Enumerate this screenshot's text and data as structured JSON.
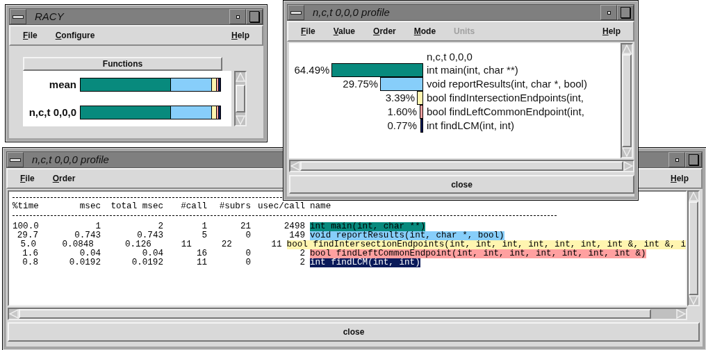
{
  "racy_window": {
    "title": "RACY",
    "menu": [
      {
        "label": "File",
        "disabled": false
      },
      {
        "label": "Configure",
        "disabled": false
      }
    ],
    "menu_right": [
      {
        "label": "Help",
        "disabled": false
      }
    ],
    "header": "Functions",
    "rows": [
      {
        "label": "mean"
      },
      {
        "label": "n,c,t 0,0,0"
      }
    ]
  },
  "table_window": {
    "title": "n,c,t 0,0,0 profile",
    "menu": [
      {
        "label": "File",
        "disabled": false
      },
      {
        "label": "Order",
        "disabled": false
      }
    ],
    "menu_right": [
      {
        "label": "Help",
        "disabled": false
      }
    ],
    "columns": [
      "%time",
      "msec",
      "total msec",
      "#call",
      "#subrs",
      "usec/call",
      "name"
    ],
    "rows": [
      {
        "cells": [
          "100.0",
          "1",
          "2",
          "1",
          "21",
          "2498"
        ],
        "name": "int main(int, char **)",
        "color": "#088a7d"
      },
      {
        "cells": [
          "29.7",
          "0.743",
          "0.743",
          "5",
          "0",
          "149"
        ],
        "name": "void reportResults(int, char *, bool)",
        "color": "#87cefa"
      },
      {
        "cells": [
          "5.0",
          "0.0848",
          "0.126",
          "11",
          "22",
          "11"
        ],
        "name": "bool findIntersectionEndpoints(int, int, int, int, int, int, int &, int &, i",
        "color": "#fff5b0"
      },
      {
        "cells": [
          "1.6",
          "0.04",
          "0.04",
          "16",
          "0",
          "2"
        ],
        "name": "bool findLeftCommonEndpoint(int, int, int, int, int, int, int &)",
        "color": "#ffa0a0"
      },
      {
        "cells": [
          "0.8",
          "0.0192",
          "0.0192",
          "11",
          "0",
          "2"
        ],
        "name": "int findLCM(int, int)",
        "color": "#0a1a5a"
      }
    ],
    "close": "close"
  },
  "profile_window": {
    "title": "n,c,t 0,0,0 profile",
    "menu": [
      {
        "label": "File",
        "disabled": false
      },
      {
        "label": "Value",
        "disabled": false
      },
      {
        "label": "Order",
        "disabled": false
      },
      {
        "label": "Mode",
        "disabled": false
      },
      {
        "label": "Units",
        "disabled": true
      }
    ],
    "menu_right": [
      {
        "label": "Help",
        "disabled": false
      }
    ],
    "node": "n,c,t 0,0,0",
    "rows": [
      {
        "percent": "64.49%",
        "level": 0.6449,
        "color": "#088a7d",
        "name": "int main(int, char **)"
      },
      {
        "percent": "29.75%",
        "level": 0.2975,
        "color": "#87cefa",
        "name": "void reportResults(int, char *, bool)"
      },
      {
        "percent": "3.39%",
        "level": 0.0339,
        "color": "#fff5b0",
        "name": "bool findIntersectionEndpoints(int,"
      },
      {
        "percent": "1.60%",
        "level": 0.016,
        "color": "#ffa0a0",
        "name": "bool findLeftCommonEndpoint(int,"
      },
      {
        "percent": "0.77%",
        "level": 0.0077,
        "color": "#0a1a5a",
        "name": "int findLCM(int, int)"
      }
    ],
    "close": "close"
  }
}
